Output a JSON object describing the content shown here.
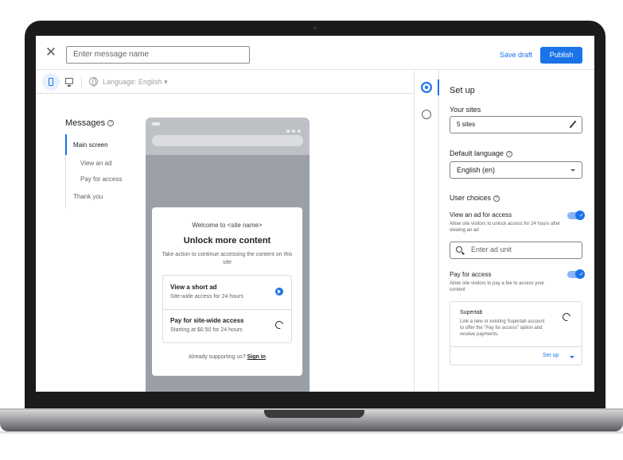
{
  "header": {
    "message_name_placeholder": "Enter message name",
    "save_draft_label": "Save draft",
    "publish_label": "Publish"
  },
  "toolbar": {
    "language_label": "Language: English"
  },
  "messages": {
    "title": "Messages",
    "nav": [
      {
        "label": "Main screen"
      },
      {
        "label": "View an ad"
      },
      {
        "label": "Pay for access"
      },
      {
        "label": "Thank you"
      }
    ]
  },
  "preview": {
    "welcome": "Welcome to <site name>",
    "headline": "Unlock more content",
    "description": "Take action to continue accessing the content on this site",
    "options": [
      {
        "title": "View a short ad",
        "subtitle": "Site-wide access for 24 hours",
        "selected": true
      },
      {
        "title": "Pay for site-wide access",
        "subtitle": "Starting at $0.50 for 24 hours",
        "selected": false
      }
    ],
    "already_text": "Already supporting us?",
    "sign_in_label": "Sign in"
  },
  "settings": {
    "title": "Set up",
    "your_sites_label": "Your sites",
    "your_sites_value": "5 sites",
    "default_language_label": "Default language",
    "default_language_value": "English (en)",
    "user_choices_label": "User choices",
    "view_ad": {
      "title": "View an ad for access",
      "description": "Allow site visitors to unlock access for 24 hours after viewing an ad",
      "enabled": true
    },
    "ad_unit_placeholder": "Enter ad unit",
    "pay_access": {
      "title": "Pay for access",
      "description": "Allow site visitors to pay a fee to access your content",
      "enabled": true
    },
    "supertab": {
      "title": "Supertab",
      "description": "Link a new or existing Supertab account to offer the \"Pay for access\" option and receive payments.",
      "action_label": "Set up"
    }
  },
  "colors": {
    "accent": "#1a73e8"
  }
}
